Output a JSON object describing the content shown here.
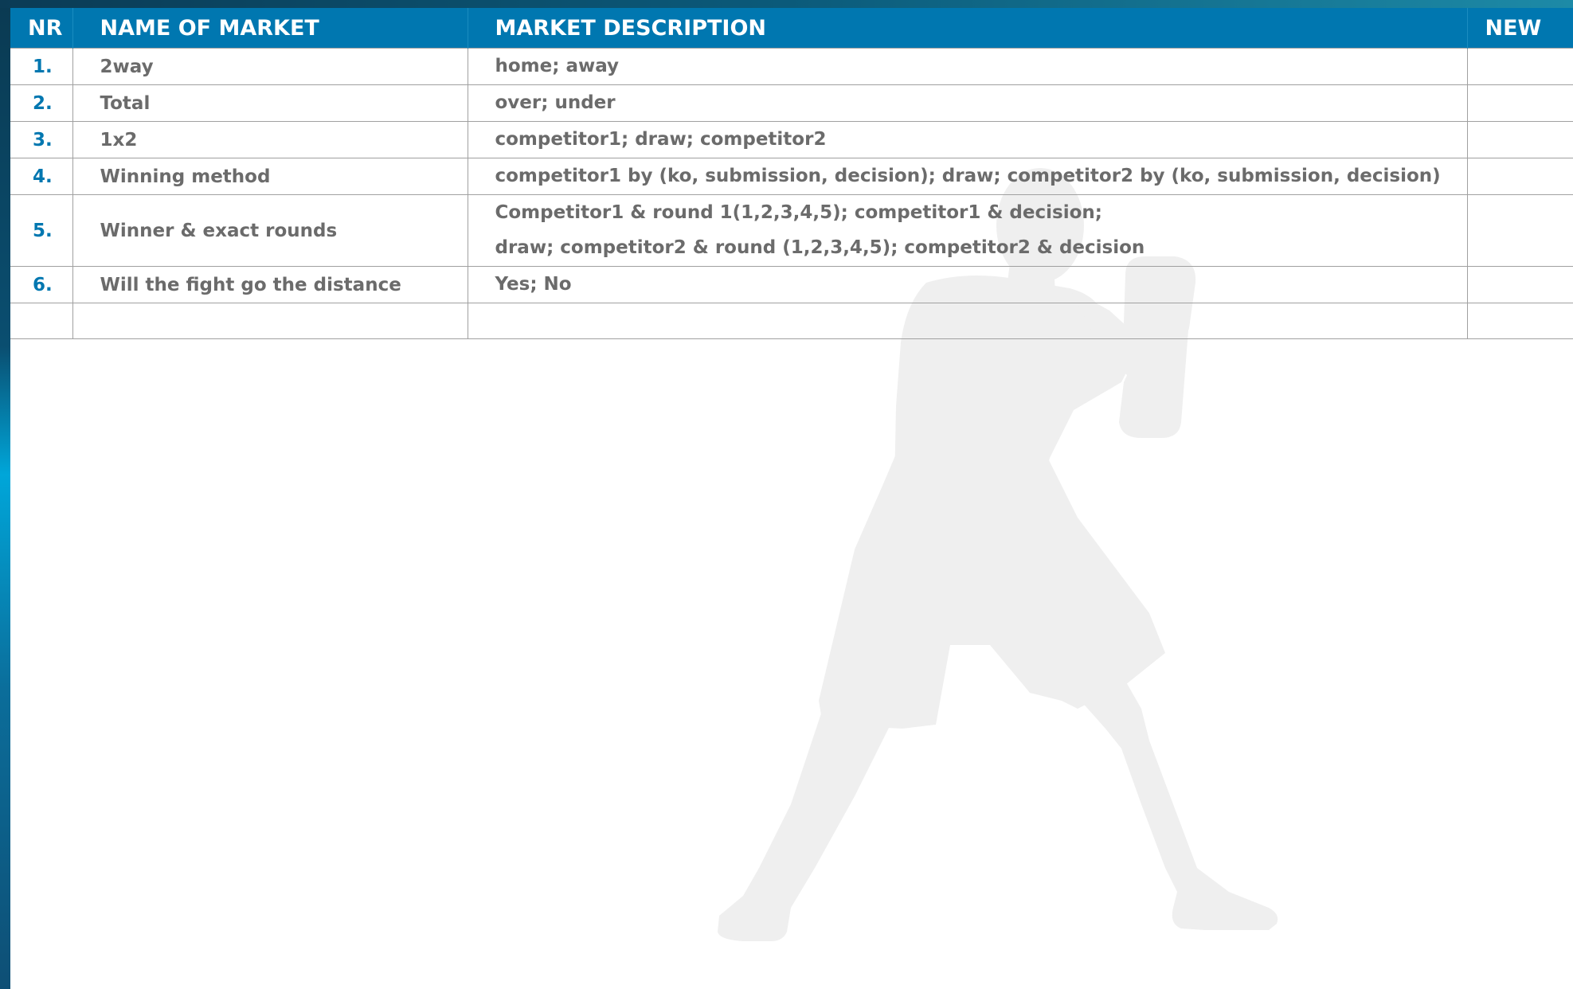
{
  "table": {
    "headers": {
      "nr": "NR",
      "name": "NAME OF MARKET",
      "description": "MARKET DESCRIPTION",
      "new": "NEW"
    },
    "rows": [
      {
        "nr": "1.",
        "name": "2way",
        "description": [
          "home; away"
        ],
        "new": ""
      },
      {
        "nr": "2.",
        "name": "Total",
        "description": [
          "over; under"
        ],
        "new": ""
      },
      {
        "nr": "3.",
        "name": "1x2",
        "description": [
          "competitor1; draw; competitor2"
        ],
        "new": ""
      },
      {
        "nr": "4.",
        "name": "Winning method",
        "description": [
          "competitor1 by (ko, submission, decision); draw; competitor2 by (ko, submission, decision)"
        ],
        "new": ""
      },
      {
        "nr": "5.",
        "name": "Winner & exact rounds",
        "description": [
          "Competitor1 & round 1(1,2,3,4,5); competitor1 & decision;",
          "draw; competitor2 & round (1,2,3,4,5); competitor2 & decision"
        ],
        "new": ""
      },
      {
        "nr": "6.",
        "name": "Will the fight go the distance",
        "description": [
          "Yes; No"
        ],
        "new": ""
      }
    ]
  },
  "background": {
    "watermark_icon": "boxer-silhouette-icon",
    "colors": {
      "header": "#0077b0",
      "number_text": "#0077b0",
      "body_text": "#6b6b6b",
      "watermark": "#efefef"
    }
  }
}
